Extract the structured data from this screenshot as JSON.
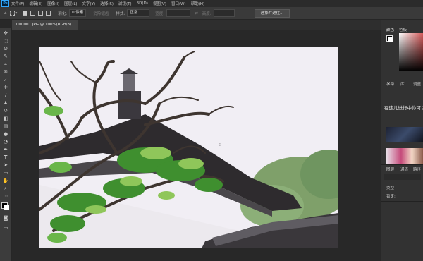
{
  "menubar": {
    "logo": "Ps",
    "items": [
      "文件(F)",
      "编辑(E)",
      "图像(I)",
      "图层(L)",
      "文字(Y)",
      "选择(S)",
      "滤镜(T)",
      "3D(D)",
      "视图(V)",
      "窗口(W)",
      "帮助(H)"
    ]
  },
  "options": {
    "feather_label": "羽化:",
    "feather_value": "0 像素",
    "antialias": "消除锯齿",
    "style_label": "样式:",
    "style_value": "正常",
    "width_label": "宽度:",
    "height_label": "高度:",
    "select_mask_button": "选择并遮住..."
  },
  "document": {
    "tab_label": "000001.JPG @ 100%(RGB/8)"
  },
  "panels": {
    "color_tab": "颜色",
    "swatches_tab": "色板",
    "learn_tab": "学习",
    "libraries_tab": "库",
    "adjust_tab": "调整",
    "learn_title": "在这儿进行中你可以学习入门知识",
    "layers_tab": "图层",
    "channels_tab": "通道",
    "paths_tab": "路径",
    "kind_label": "类型",
    "lock_label": "锁定:"
  }
}
